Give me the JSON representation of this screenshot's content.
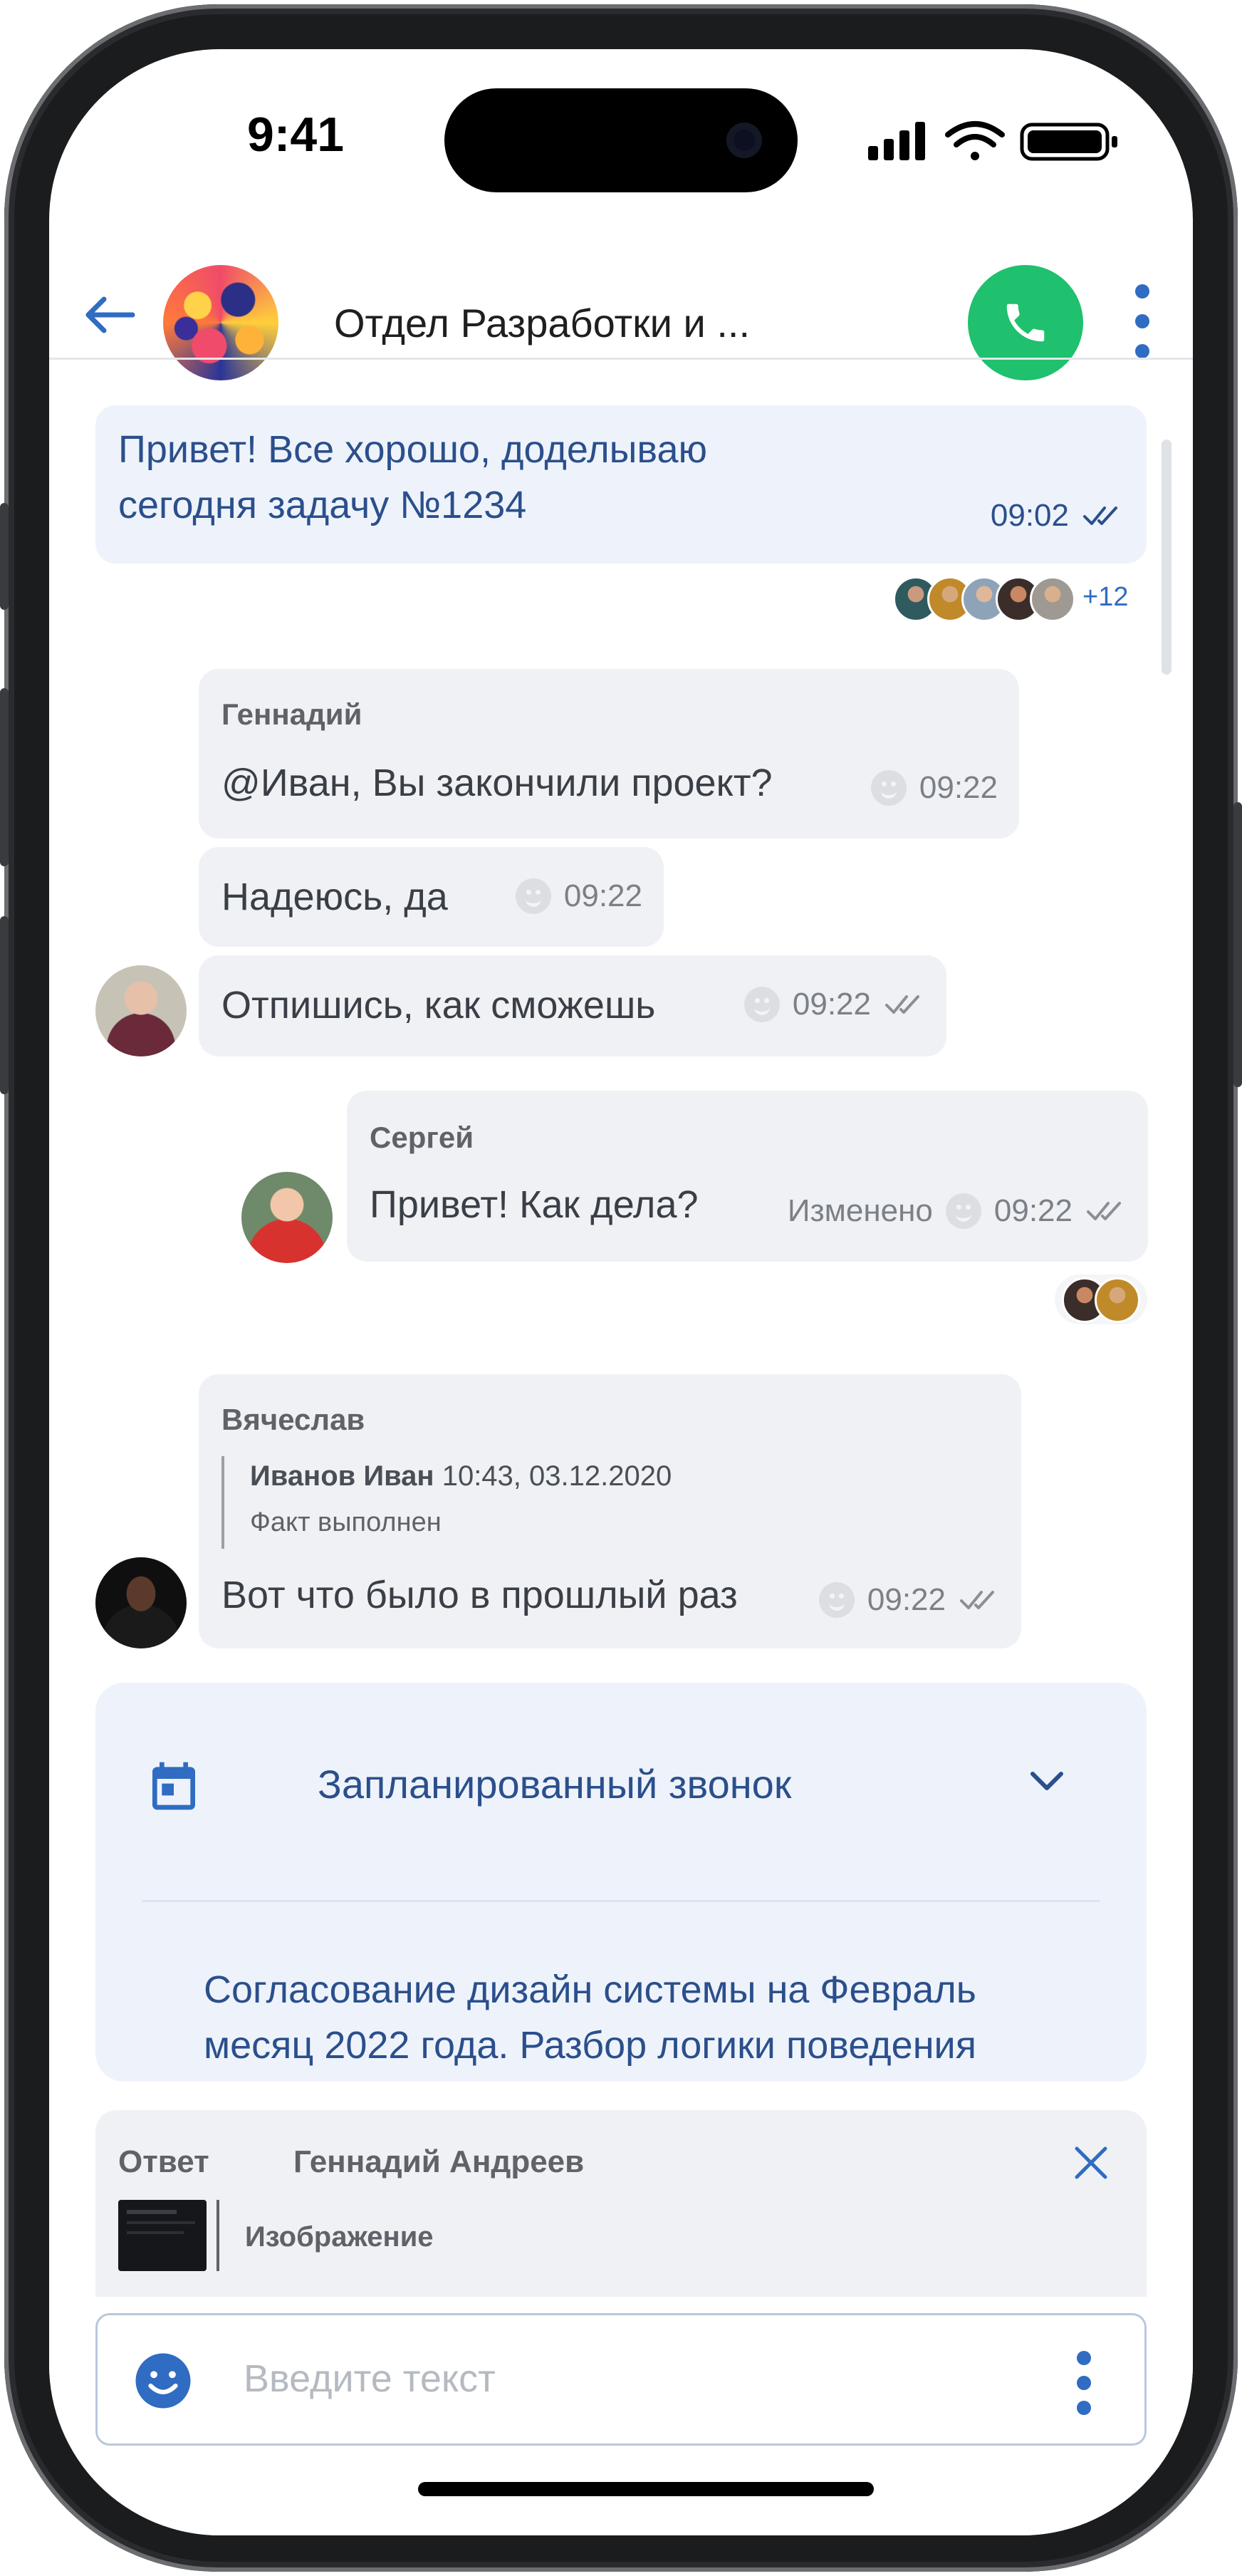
{
  "status_bar": {
    "time": "9:41"
  },
  "header": {
    "title": "Отдел Разработки и ...",
    "back_icon": "arrow-left-icon",
    "call_icon": "phone-icon",
    "menu_icon": "more-vertical-icon"
  },
  "messages": [
    {
      "text_lines": [
        "Привет! Все хорошо, доделываю",
        "сегодня задачу №1234"
      ],
      "time": "09:02",
      "readers_more": "+12"
    },
    {
      "sender": "Геннадий",
      "text": "@Иван, Вы закончили проект?",
      "time": "09:22"
    },
    {
      "text": "Надеюсь, да",
      "time": "09:22"
    },
    {
      "text": "Отпишись, как сможешь",
      "time": "09:22"
    },
    {
      "sender": "Сергей",
      "text": "Привет! Как дела?",
      "edited": "Изменено",
      "time": "09:22"
    },
    {
      "sender": "Вячеслав",
      "quote": {
        "author": "Иванов Иван",
        "datetime": "10:43, 03.12.2020",
        "text": "Факт выполнен"
      },
      "text": "Вот что было в прошлый раз",
      "time": "09:22"
    }
  ],
  "scheduled_call": {
    "title": "Запланированный звонок",
    "description_lines": [
      "Согласование дизайн системы на Февраль",
      "месяц 2022 года. Разбор логики поведения"
    ],
    "icon": "calendar-icon"
  },
  "reply": {
    "label": "Ответ",
    "author": "Геннадий Андреев",
    "attachment": "Изображение",
    "close_icon": "close-icon"
  },
  "composer": {
    "placeholder": "Введите текст",
    "emoji_icon": "emoji-icon",
    "menu_icon": "more-vertical-icon"
  },
  "colors": {
    "accent": "#2f6cc2",
    "call_green": "#1fc06e",
    "my_bubble": "#eef3fb",
    "other_bubble": "#eff1f4"
  }
}
